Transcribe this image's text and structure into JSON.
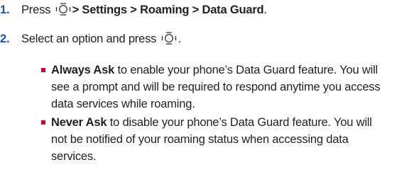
{
  "steps": [
    {
      "number": "1.",
      "prefix": "Press",
      "path": "> Settings > Roaming > Data Guard",
      "suffix": ".",
      "icon": "navigation-key-icon"
    },
    {
      "number": "2.",
      "prefix": "Select an option and press",
      "suffix": ".",
      "icon": "navigation-key-icon"
    }
  ],
  "options": [
    {
      "label": "Always Ask",
      "lines": [
        " to enable your phone’s Data Guard feature. You will",
        "see a prompt and will be required to respond anytime you access",
        "data services while roaming."
      ]
    },
    {
      "label": "Never Ask",
      "lines": [
        " to disable your phone’s Data Guard feature. You will",
        "not be notified of your roaming status when accessing data",
        "services."
      ]
    }
  ],
  "colors": {
    "number": "#1a56a6",
    "bullet": "#cc0033",
    "text": "#231f20"
  }
}
